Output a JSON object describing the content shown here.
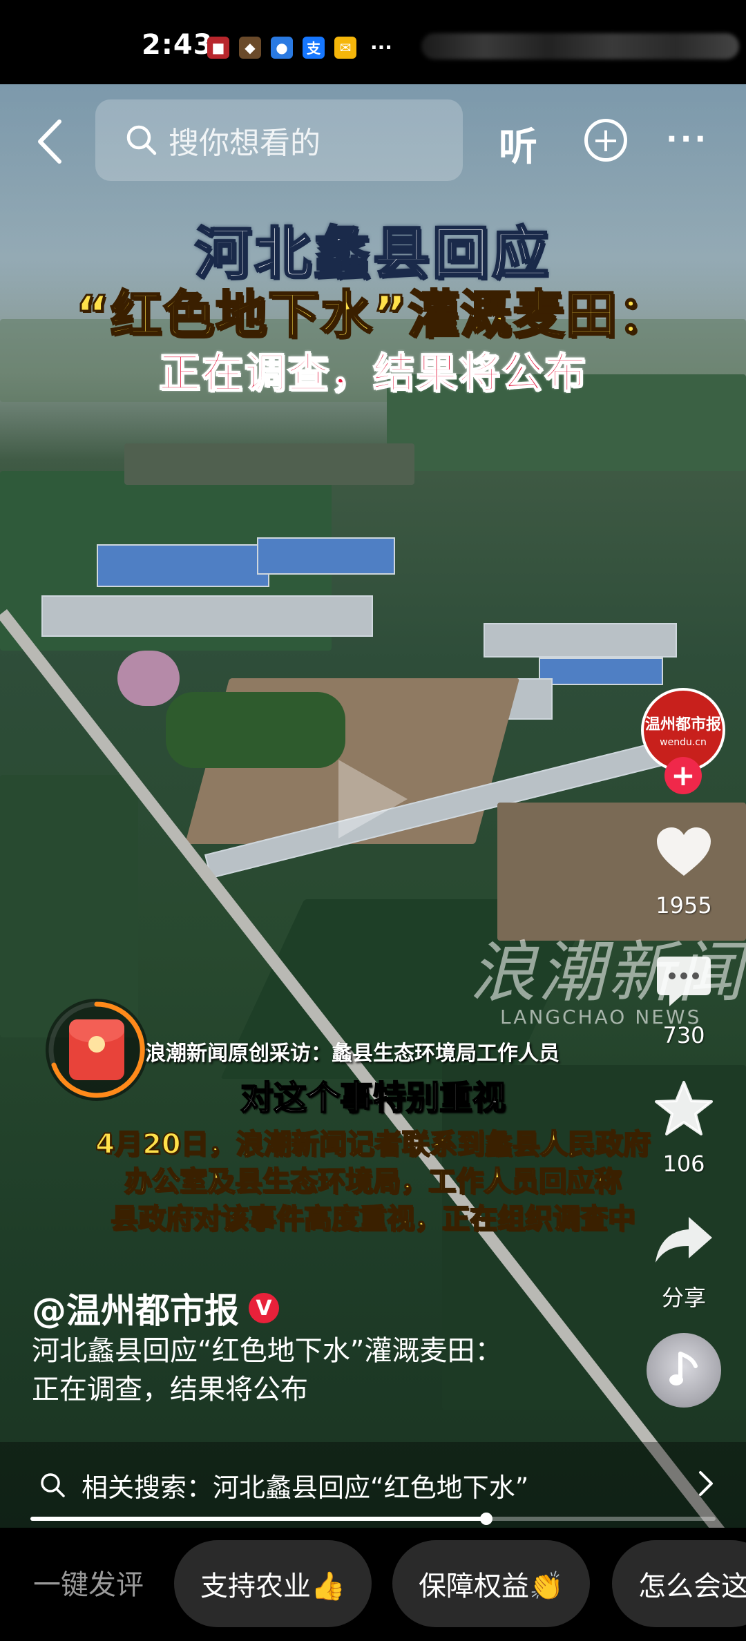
{
  "status_bar": {
    "time": "2:43",
    "app_icons": [
      {
        "name": "app-notification-icon-1",
        "color": "#b8262c",
        "glyph": "■"
      },
      {
        "name": "shield-app-icon",
        "color": "#6a4a2a",
        "glyph": "◆"
      },
      {
        "name": "app-notification-icon-3",
        "color": "#2a7ae2",
        "glyph": "●"
      },
      {
        "name": "alipay-icon",
        "color": "#1677ff",
        "glyph": "支"
      },
      {
        "name": "mail-icon",
        "color": "#f5b60a",
        "glyph": "✉"
      }
    ],
    "more": "···"
  },
  "nav": {
    "search_placeholder": "搜你想看的",
    "listen_label": "听",
    "plus_label": "+",
    "more_label": "···"
  },
  "video": {
    "headline_line1": "河北蠡县回应",
    "headline_line2": "“红色地下水”灌溉麦田：",
    "headline_line3": "正在调查，结果将公布",
    "watermark_cn": "浪潮新闻",
    "watermark_en": "LANGCHAO NEWS",
    "subtitle_small": "浪潮新闻原创采访：蠡县生态环境局工作人员",
    "subtitle_main": "对这个事特别重视",
    "subtitle_lines": [
      "4月20日，浪潮新闻记者联系到蠡县人民政府",
      "办公室及县生态环境局，工作人员回应称",
      "县政府对该事件高度重视，正在组织调查中"
    ]
  },
  "rail": {
    "avatar_name": "温州都市报",
    "avatar_sub": "wendu.cn",
    "follow": "+",
    "likes": "1955",
    "comments": "730",
    "favorites": "106",
    "share_label": "分享"
  },
  "post": {
    "author": "@温州都市报",
    "verified": "V",
    "caption_line1": "河北蠡县回应“红色地下水”灌溉麦田：",
    "caption_line2": "正在调查，结果将公布"
  },
  "related": {
    "text": "相关搜索：河北蠡县回应“红色地下水”"
  },
  "progress": {
    "fraction": 0.665
  },
  "bottom": {
    "quick_label": "一键发评",
    "chips": [
      "支持农业👍",
      "保障权益👏",
      "怎么会这"
    ]
  },
  "colors": {
    "accent_red": "#f0284a",
    "headline_yellow": "#ffe14a",
    "headline_red": "#e3173c"
  }
}
